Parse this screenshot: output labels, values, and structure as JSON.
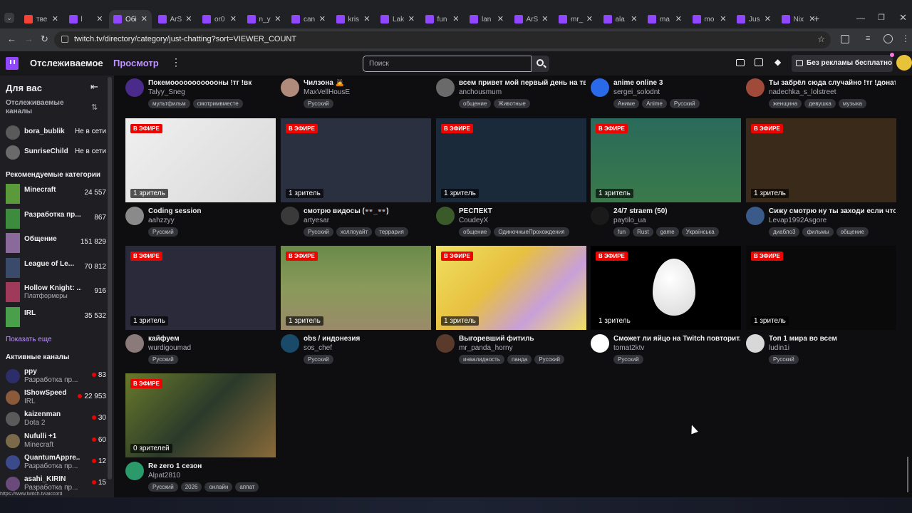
{
  "browser": {
    "tabs": [
      {
        "label": "тве",
        "color": "#f44336"
      },
      {
        "label": "l",
        "color": "#9146ff"
      },
      {
        "label": "Обі",
        "color": "#9146ff"
      },
      {
        "label": "ArS",
        "color": "#9146ff"
      },
      {
        "label": "or0",
        "color": "#9146ff"
      },
      {
        "label": "n_y",
        "color": "#9146ff"
      },
      {
        "label": "can",
        "color": "#9146ff"
      },
      {
        "label": "kris",
        "color": "#9146ff"
      },
      {
        "label": "Lak",
        "color": "#9146ff"
      },
      {
        "label": "fun",
        "color": "#9146ff"
      },
      {
        "label": "lan",
        "color": "#9146ff"
      },
      {
        "label": "ArS",
        "color": "#9146ff"
      },
      {
        "label": "mr_",
        "color": "#9146ff"
      },
      {
        "label": "ala",
        "color": "#9146ff"
      },
      {
        "label": "ma",
        "color": "#9146ff"
      },
      {
        "label": "mo",
        "color": "#9146ff"
      },
      {
        "label": "Jus",
        "color": "#9146ff"
      },
      {
        "label": "Nix",
        "color": "#9146ff"
      }
    ],
    "url": "twitch.tv/directory/category/just-chatting?sort=VIEWER_COUNT",
    "status_url": "https://www.twitch.tv/aiccord"
  },
  "header": {
    "following": "Отслеживаемое",
    "browse": "Просмотр",
    "search_placeholder": "Поиск",
    "no_ads": "Без рекламы бесплатно",
    "more": "⋮"
  },
  "sidebar": {
    "for_you": "Для вас",
    "followed_label": "Отслеживаемые каналы",
    "followed": [
      {
        "name": "bora_bublik",
        "status": "Не в сети",
        "color": "#5a5a5a"
      },
      {
        "name": "SunriseChild",
        "status": "Не в сети",
        "color": "#6a6a6a"
      }
    ],
    "rec_categories_label": "Рекомендуемые категории",
    "categories": [
      {
        "name": "Minecraft",
        "sub": "",
        "viewers": "24 557",
        "color": "#5a9a3a"
      },
      {
        "name": "Разработка пр...",
        "sub": "",
        "viewers": "867",
        "color": "#3d8c3d"
      },
      {
        "name": "Общение",
        "sub": "",
        "viewers": "151 829",
        "color": "#8a6a9a"
      },
      {
        "name": "League of Le...",
        "sub": "",
        "viewers": "70 812",
        "color": "#3a4a6a"
      },
      {
        "name": "Hollow Knight: ...",
        "sub": "Платформеры",
        "viewers": "916",
        "color": "#a03a5a"
      },
      {
        "name": "IRL",
        "sub": "",
        "viewers": "35 532",
        "color": "#4aa04a"
      }
    ],
    "show_more": "Показать еще",
    "active_label": "Активные каналы",
    "active": [
      {
        "name": "ppy",
        "sub": "Разработка пр...",
        "viewers": "83",
        "color": "#2d2d6a"
      },
      {
        "name": "IShowSpeed",
        "sub": "IRL",
        "viewers": "22 953",
        "color": "#8a5a3a"
      },
      {
        "name": "kaizenman",
        "sub": "Dota 2",
        "viewers": "30",
        "color": "#5a5a5a"
      },
      {
        "name": "Nufulli +1",
        "sub": "Minecraft",
        "viewers": "60",
        "color": "#7a6a4a"
      },
      {
        "name": "QuantumAppre...",
        "sub": "Разработка пр...",
        "viewers": "12",
        "color": "#3a4a8a"
      },
      {
        "name": "asahi_KIRIN",
        "sub": "Разработка пр...",
        "viewers": "15",
        "color": "#6a4a7a"
      }
    ]
  },
  "live_label": "В ЭФИРЕ",
  "streams": [
    {
      "title": "Покемоооооооооооны !тг !вк",
      "channel": "Talyy_Sneg",
      "tags": [
        "мультфильм",
        "смотримвместе"
      ],
      "viewers": "",
      "avatar": "#4a2a8a",
      "thumb": "none"
    },
    {
      "title": "Чилзона 🙇",
      "channel": "MaxVellHousE",
      "tags": [
        "Русский"
      ],
      "viewers": "",
      "avatar": "#b08a7a",
      "thumb": "none"
    },
    {
      "title": "всем привет мой первый день на тв...",
      "channel": "anchousmum",
      "tags": [
        "общение",
        "Животные"
      ],
      "viewers": "",
      "avatar": "#6a6a6a",
      "thumb": "none"
    },
    {
      "title": "anime online 3",
      "channel": "sergei_solodnt",
      "tags": [
        "Аниме",
        "Anime",
        "Русский"
      ],
      "viewers": "",
      "avatar": "#2a6ae8",
      "thumb": "none"
    },
    {
      "title": "Ты забрёл сюда случайно !тг !донат",
      "channel": "nadechka_s_lolstreet",
      "tags": [
        "женщина",
        "девушка",
        "музыка"
      ],
      "viewers": "",
      "avatar": "#a04a3a",
      "thumb": "none"
    },
    {
      "title": "Coding session",
      "channel": "aahzzyy",
      "tags": [
        "Русский"
      ],
      "viewers": "1 зритель",
      "avatar": "#8a8a8a",
      "thumb": "#e8e8e8"
    },
    {
      "title": "смотрю видосы (👓_👓)",
      "channel": "artyesar",
      "tags": [
        "Русский",
        "холлоуайт",
        "террария"
      ],
      "viewers": "1 зритель",
      "avatar": "#3a3a3a",
      "thumb": "#2a3040"
    },
    {
      "title": "РЕСПЕКТ",
      "channel": "CoudeyX",
      "tags": [
        "общение",
        "ОдиночныеПрохождения"
      ],
      "viewers": "1 зритель",
      "avatar": "#3a5a2a",
      "thumb": "#1a2a3a"
    },
    {
      "title": "24/7 straem (50)",
      "channel": "paytilo_ua",
      "tags": [
        "fun",
        "Rust",
        "game",
        "Українська"
      ],
      "viewers": "1 зритель",
      "avatar": "#1a1a1a",
      "thumb": "#2a5a3a"
    },
    {
      "title": "Сижу смотрю ну ты заходи если что",
      "channel": "Levap1992Asgore",
      "tags": [
        "диабло3",
        "фильмы",
        "общение"
      ],
      "viewers": "1 зритель",
      "avatar": "#3a5a8a",
      "thumb": "#3a2a1a"
    },
    {
      "title": "кайфуем",
      "channel": "wurdigoumad",
      "tags": [
        "Русский"
      ],
      "viewers": "1 зритель",
      "avatar": "#8a7a7a",
      "thumb": "#2a2a3a"
    },
    {
      "title": "obs / индонезия",
      "channel": "sos_chef",
      "tags": [
        "Русский"
      ],
      "viewers": "1 зритель",
      "avatar": "#1a4a6a",
      "thumb": "#4a6a2a"
    },
    {
      "title": "Выгоревший фитиль",
      "channel": "mr_panda_horny",
      "tags": [
        "инвалидность",
        "панда",
        "Русский"
      ],
      "viewers": "1 зритель",
      "avatar": "#5a3a2a",
      "thumb": "#e8d84a"
    },
    {
      "title": "Сможет ли яйцо на Twitch повторит...",
      "channel": "tomat2ktv",
      "tags": [
        "Русский"
      ],
      "viewers": "1 зритель",
      "avatar": "#ffffff",
      "thumb": "#000000"
    },
    {
      "title": "Топ 1 мира во всем",
      "channel": "ludin1i",
      "tags": [
        "Русский"
      ],
      "viewers": "1 зритель",
      "avatar": "#d8d8d8",
      "thumb": "#0a0a0a"
    },
    {
      "title": "Re zero 1 сезон",
      "channel": "Alpat2810",
      "tags": [
        "Русский",
        "2026",
        "онлайн",
        "аппат"
      ],
      "viewers": "0 зрителей",
      "avatar": "#2a9a6a",
      "thumb": "#5a6a2a"
    }
  ]
}
